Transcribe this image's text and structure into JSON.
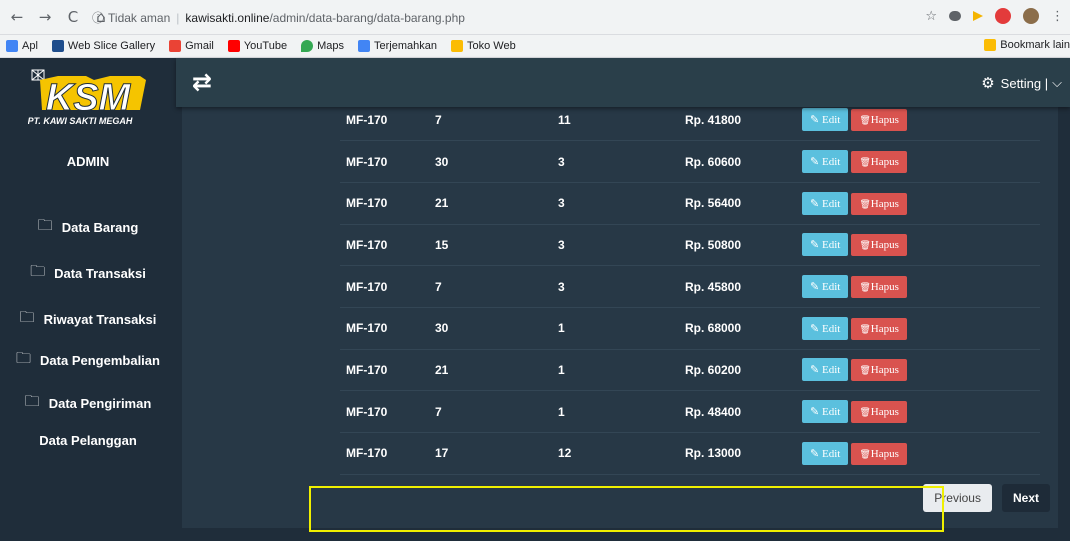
{
  "browser": {
    "nav": [
      "←",
      "→",
      "C",
      "⌂"
    ],
    "info_icon": "ⓘ",
    "security": "Tidak aman",
    "host": "kawisakti.online",
    "path": "/admin/data-barang/data-barang.php",
    "star": "☆"
  },
  "bookmarks": {
    "items": [
      {
        "label": "Apl",
        "color": "#4285f4"
      },
      {
        "label": "Web Slice Gallery",
        "color": "#1e4d8c"
      },
      {
        "label": "Gmail",
        "color": "#ea4335"
      },
      {
        "label": "YouTube",
        "color": "#ff0000"
      },
      {
        "label": "Maps",
        "color": "#34a853"
      },
      {
        "label": "Terjemahkan",
        "color": "#4285f4"
      },
      {
        "label": "Toko Web",
        "color": "#fbbc04"
      }
    ],
    "right": "Bookmark lain"
  },
  "sidebar": {
    "logo_text": "KSM",
    "logo_sub": "PT. KAWI SAKTI MEGAH",
    "role": "ADMIN",
    "items": [
      {
        "label": "Data Barang",
        "icon": "folder-icon"
      },
      {
        "label": "Data Transaksi",
        "icon": "folder-icon"
      },
      {
        "label": "Riwayat Transaksi",
        "icon": "folder-icon"
      },
      {
        "label": "Data Pengembalian",
        "icon": "folder-icon"
      },
      {
        "label": "Data Pengiriman",
        "icon": "folder-icon"
      },
      {
        "label": "Data Pelanggan",
        "icon": ""
      }
    ]
  },
  "topbar": {
    "toggle_icon": "⇄",
    "setting_label": "Setting |",
    "setting_icon": "⚙",
    "chevron": "⌵"
  },
  "table": {
    "rows": [
      {
        "code": "MF-170",
        "a": "7",
        "b": "11",
        "price": "Rp. 41800"
      },
      {
        "code": "MF-170",
        "a": "30",
        "b": "3",
        "price": "Rp. 60600"
      },
      {
        "code": "MF-170",
        "a": "21",
        "b": "3",
        "price": "Rp. 56400"
      },
      {
        "code": "MF-170",
        "a": "15",
        "b": "3",
        "price": "Rp. 50800"
      },
      {
        "code": "MF-170",
        "a": "7",
        "b": "3",
        "price": "Rp. 45800"
      },
      {
        "code": "MF-170",
        "a": "30",
        "b": "1",
        "price": "Rp. 68000"
      },
      {
        "code": "MF-170",
        "a": "21",
        "b": "1",
        "price": "Rp. 60200"
      },
      {
        "code": "MF-170",
        "a": "7",
        "b": "1",
        "price": "Rp. 48400"
      },
      {
        "code": "MF-170",
        "a": "17",
        "b": "12",
        "price": "Rp. 13000"
      }
    ],
    "edit_label": "Edit",
    "edit_icon": "✎",
    "delete_label": "Hapus",
    "delete_icon": "🗑"
  },
  "pagination": {
    "prev": "Previous",
    "next": "Next"
  },
  "colors": {
    "highlight": "#f0f000",
    "edit": "#5bc0de",
    "delete": "#d9534f"
  }
}
